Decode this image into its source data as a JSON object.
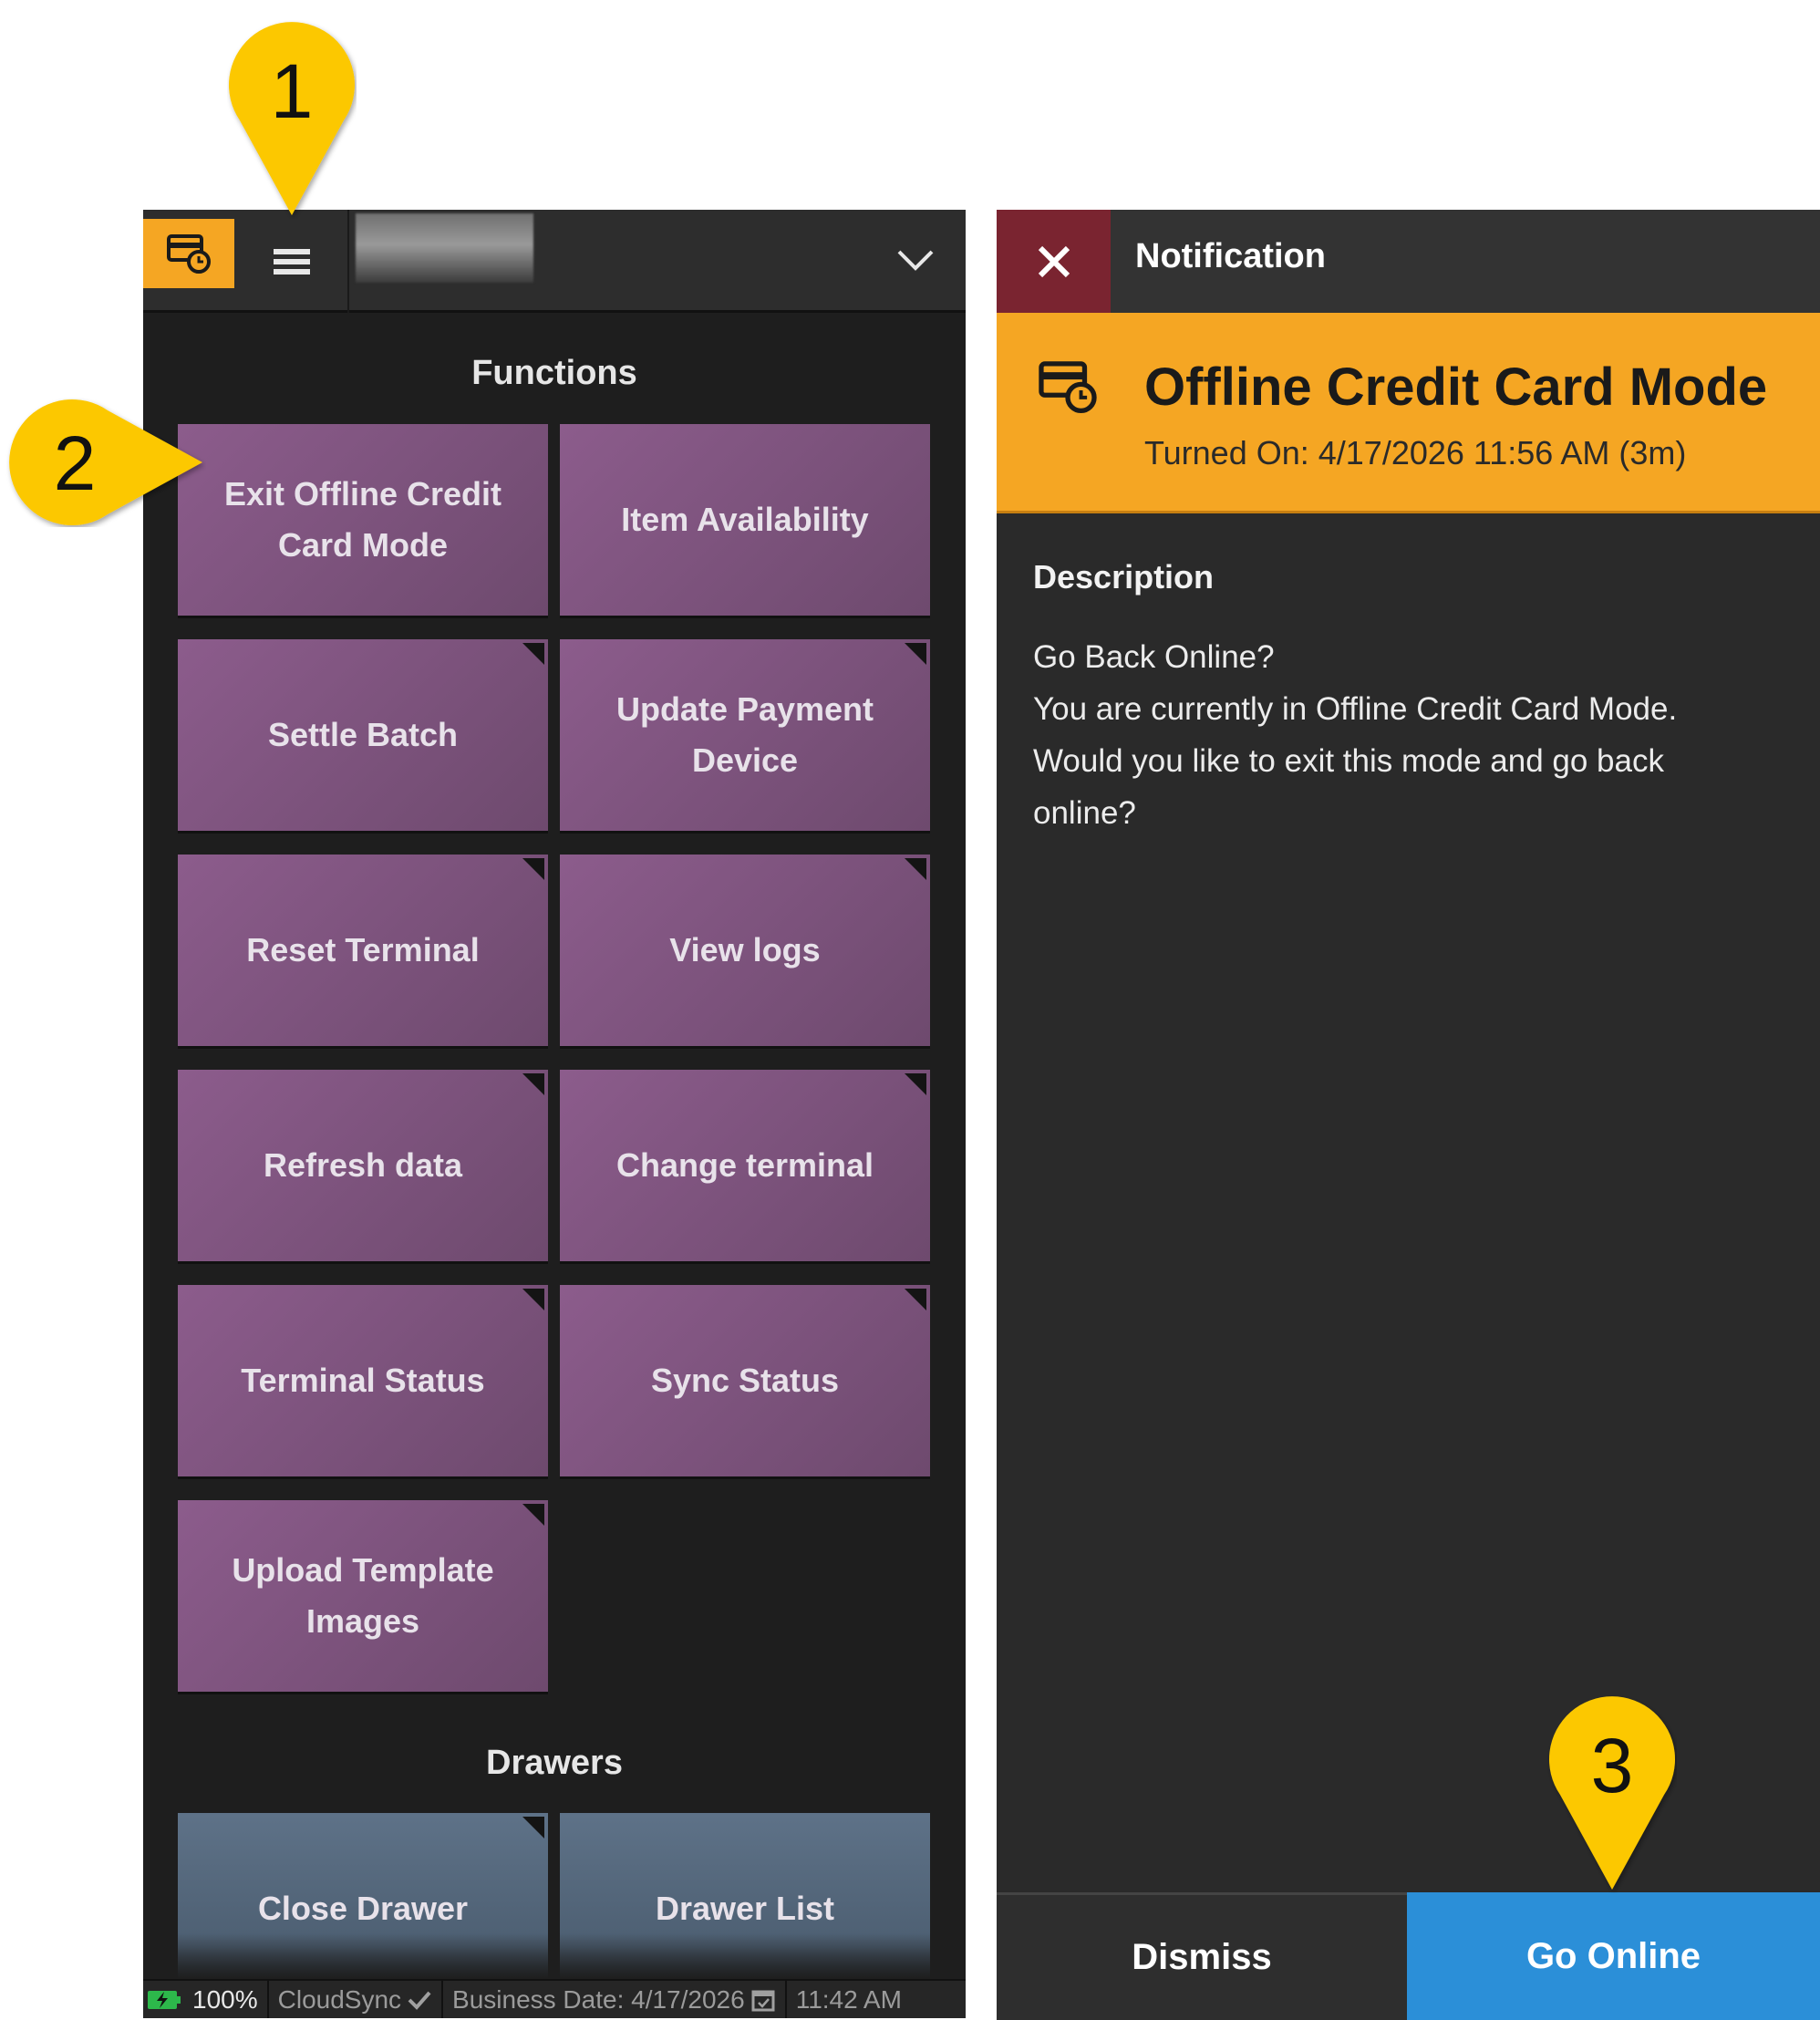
{
  "left_panel": {
    "functions_title": "Functions",
    "drawers_title": "Drawers",
    "function_tiles": [
      {
        "label": "Exit Offline Credit Card Mode",
        "has_corner": false
      },
      {
        "label": "Item Availability",
        "has_corner": false
      },
      {
        "label": "Settle Batch",
        "has_corner": true
      },
      {
        "label": "Update Payment Device",
        "has_corner": true
      },
      {
        "label": "Reset Terminal",
        "has_corner": true
      },
      {
        "label": "View logs",
        "has_corner": true
      },
      {
        "label": "Refresh data",
        "has_corner": true
      },
      {
        "label": "Change terminal",
        "has_corner": true
      },
      {
        "label": "Terminal Status",
        "has_corner": true
      },
      {
        "label": "Sync Status",
        "has_corner": true
      },
      {
        "label": "Upload Template Images",
        "has_corner": true
      }
    ],
    "drawer_tiles": [
      {
        "label": "Close Drawer",
        "has_corner": true
      },
      {
        "label": "Drawer List",
        "has_corner": false
      }
    ],
    "status_bar": {
      "battery": "100%",
      "cloudsync": "CloudSync",
      "business_date": "Business Date: 4/17/2026",
      "time": "11:42 AM"
    }
  },
  "notification": {
    "header_title": "Notification",
    "alert_title": "Offline Credit Card Mode",
    "alert_subtitle": "Turned On: 4/17/2026 11:56 AM (3m)",
    "description_label": "Description",
    "description_lines": [
      "Go Back Online?",
      "You are currently in Offline Credit Card Mode.",
      "Would you like to exit this mode and go back",
      "online?"
    ],
    "dismiss_label": "Dismiss",
    "go_online_label": "Go Online"
  },
  "callouts": [
    "1",
    "2",
    "3"
  ],
  "colors": {
    "accent_orange": "#f5a623",
    "tile_purple": "#7d527d",
    "drawer_blue": "#566a80",
    "go_online_blue": "#2b8fd8",
    "close_red": "#7a2430",
    "callout_yellow": "#fcc800"
  },
  "icons": {
    "offline_badge": "credit-card-clock-icon",
    "menu": "hamburger-menu-icon",
    "dropdown": "chevron-down-icon",
    "close": "close-icon",
    "battery": "battery-charging-icon",
    "sync": "check-icon",
    "calendar": "calendar-icon"
  }
}
